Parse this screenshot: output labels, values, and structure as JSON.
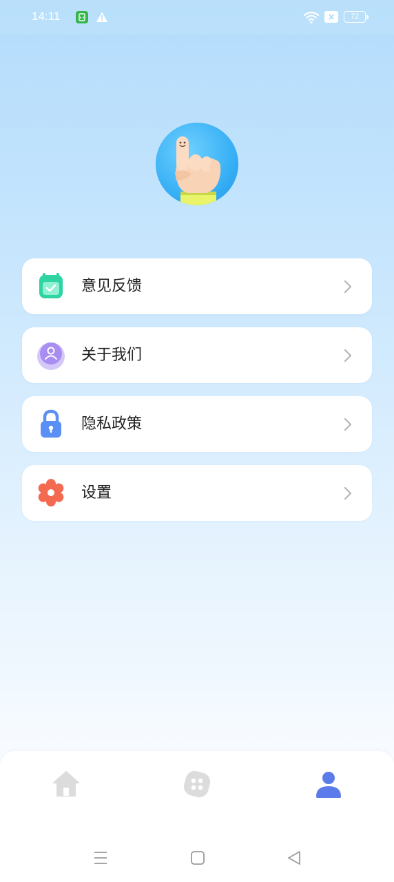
{
  "status_bar": {
    "time": "14:11",
    "battery": "72",
    "icons": [
      "app-notification-icon",
      "warning-icon",
      "wifi-icon",
      "sim-x-icon",
      "battery-icon"
    ]
  },
  "profile": {
    "avatar_icon": "pointing-finger-avatar"
  },
  "menu": {
    "items": [
      {
        "label": "意见反馈",
        "icon": "feedback-calendar-icon",
        "color": "#2fd3a4"
      },
      {
        "label": "关于我们",
        "icon": "about-user-icon",
        "color": "#a98ef2"
      },
      {
        "label": "隐私政策",
        "icon": "lock-icon",
        "color": "#5a8ff5"
      },
      {
        "label": "设置",
        "icon": "gear-icon",
        "color": "#f46a50"
      }
    ]
  },
  "bottom_nav": {
    "tabs": [
      {
        "name": "home",
        "icon": "home-icon",
        "active": false
      },
      {
        "name": "apps",
        "icon": "dice-icon",
        "active": false
      },
      {
        "name": "profile",
        "icon": "user-icon",
        "active": true
      }
    ],
    "active_color": "#5b7bea",
    "inactive_color": "#dcdcdc"
  },
  "system_nav": {
    "icons": [
      "menu-icon",
      "home-square-icon",
      "back-triangle-icon"
    ]
  }
}
